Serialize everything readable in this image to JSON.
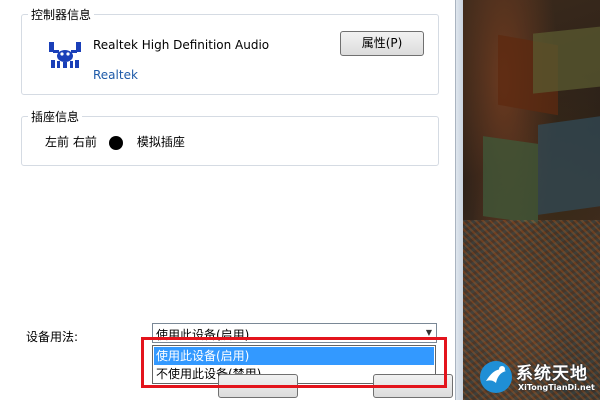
{
  "controller_group": {
    "title": "控制器信息",
    "device_name": "Realtek High Definition Audio",
    "vendor": "Realtek",
    "properties_button": "属性(P)",
    "logo_icon": "realtek-crab-icon"
  },
  "jack_group": {
    "title": "插座信息",
    "positions": "左前 右前",
    "jack_type": "模拟插座"
  },
  "device_usage": {
    "label": "设备用法:",
    "selected": "使用此设备(启用)",
    "options": [
      "使用此设备(启用)",
      "不使用此设备(禁用)"
    ]
  },
  "colors": {
    "highlight_box": "#e3141c",
    "selection": "#3399ff",
    "link": "#1e5aa8"
  },
  "watermark": {
    "title": "系统天地",
    "url": "XiTongTianDi.net"
  }
}
